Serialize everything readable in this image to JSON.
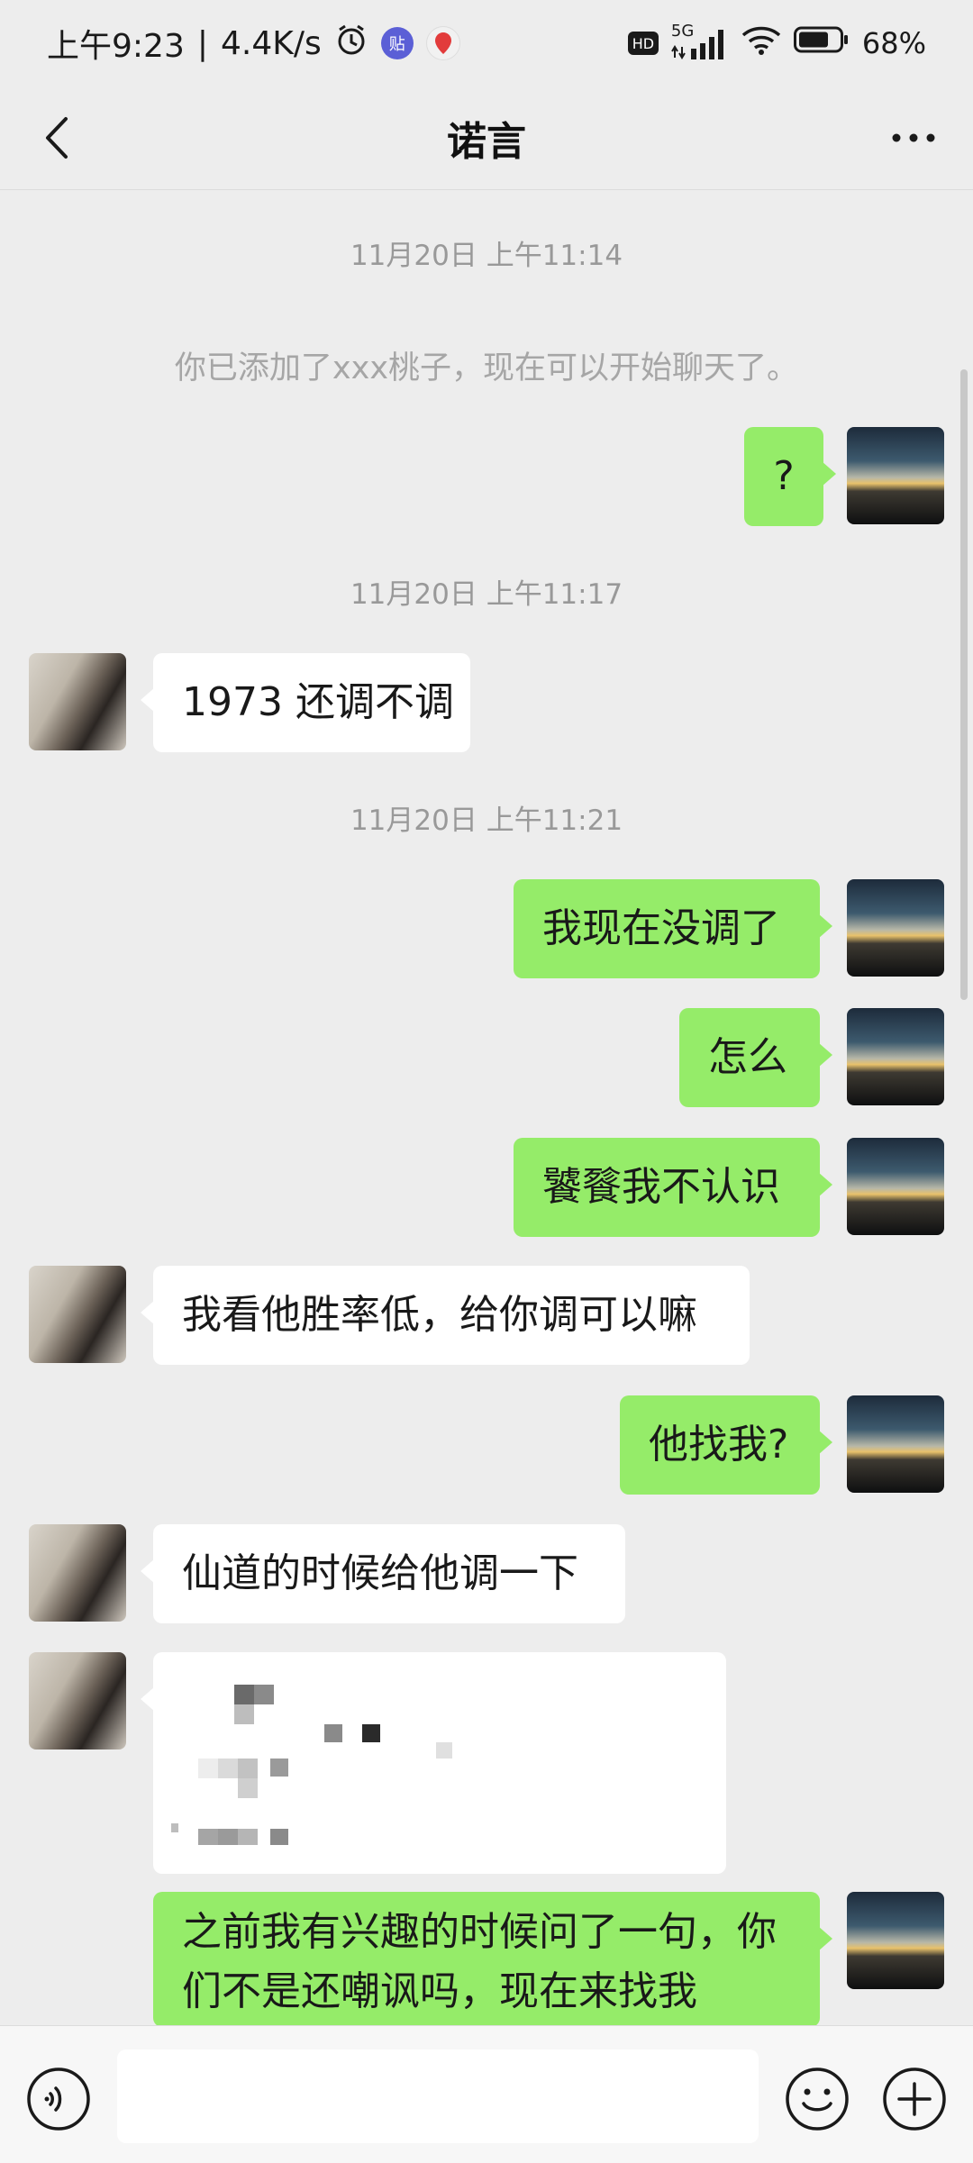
{
  "status_bar": {
    "time": "上午9:23",
    "net_speed": "4.4K/s",
    "hd": "HD",
    "network": "5G",
    "battery": "68%",
    "app_badge_1": "贴"
  },
  "header": {
    "title": "诺言"
  },
  "chat": {
    "time_1": "11月20日 上午11:14",
    "system_msg": "你已添加了xxx桃子，现在可以开始聊天了。",
    "msg_1": "?",
    "time_2": "11月20日 上午11:17",
    "msg_2": "1973 还调不调",
    "time_3": "11月20日 上午11:21",
    "msg_3": "我现在没调了",
    "msg_4": "怎么",
    "msg_5": "饕餮我不认识",
    "msg_6": "我看他胜率低，给你调可以嘛",
    "msg_7": "他找我?",
    "msg_8": "仙道的时候给他调一下",
    "msg_10": "之前我有兴趣的时候问了一句，你们不是还嘲讽吗，现在来找我"
  },
  "input": {
    "placeholder": ""
  },
  "colors": {
    "background": "#ededed",
    "my_bubble": "#95ec69",
    "other_bubble": "#ffffff"
  }
}
